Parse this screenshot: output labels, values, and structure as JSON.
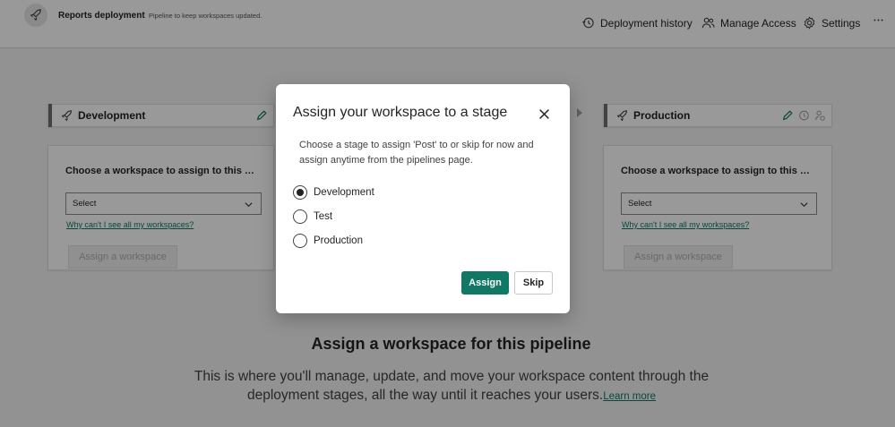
{
  "header": {
    "title": "Reports deployment",
    "subtitle": "Pipeline to keep workspaces updated.",
    "icon": "rocket-icon",
    "actions": [
      {
        "label": "Deployment history",
        "icon": "history-icon"
      },
      {
        "label": "Manage Access",
        "icon": "people-icon"
      },
      {
        "label": "Settings",
        "icon": "gear-icon"
      }
    ],
    "more_icon": "more-icon"
  },
  "stages": [
    {
      "name": "Development",
      "choose_label": "Choose a workspace to assign to this sta...",
      "select_value": "Select",
      "why_link": "Why can't I see all my workspaces?",
      "assign_button": "Assign a workspace"
    },
    {
      "name": "Production",
      "choose_label": "Choose a workspace to assign to this sta...",
      "select_value": "Select",
      "why_link": "Why can't I see all my workspaces?",
      "assign_button": "Assign a workspace"
    }
  ],
  "empty_state": {
    "title": "Assign a workspace for this pipeline",
    "description": "This is where you'll manage, update, and move your workspace content through the deployment stages, all the way until it reaches your users.",
    "link": "Learn more"
  },
  "dialog": {
    "title": "Assign your workspace to a stage",
    "description": "Choose a stage to assign 'Post' to or skip for now and assign anytime from the pipelines page.",
    "options": [
      "Development",
      "Test",
      "Production"
    ],
    "selected": "Development",
    "assign_label": "Assign",
    "skip_label": "Skip"
  },
  "colors": {
    "accent": "#117865",
    "overlay": "#000000"
  }
}
